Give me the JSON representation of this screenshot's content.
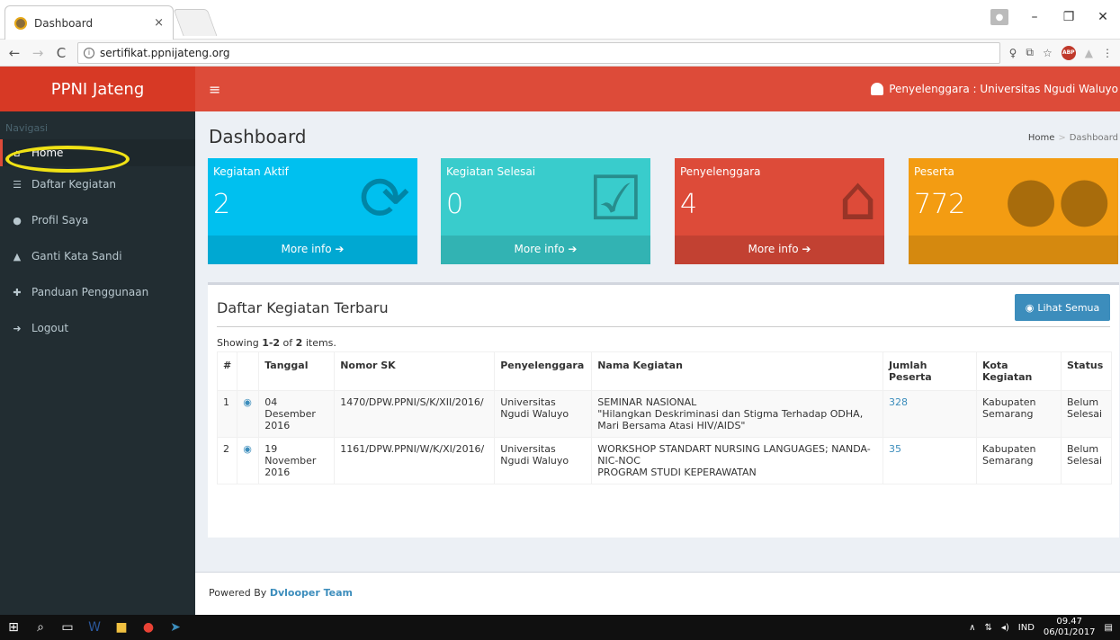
{
  "browser": {
    "tab_title": "Dashboard",
    "tab_close": "×",
    "url": "sertifikat.ppnijateng.org"
  },
  "sidebar": {
    "brand": "PPNI Jateng",
    "nav_header": "Navigasi",
    "items": [
      {
        "label": "Home",
        "icon": "home-icon",
        "glyph": "⌂"
      },
      {
        "label": "Daftar Kegiatan",
        "icon": "list-icon",
        "glyph": "☰"
      },
      {
        "label": "Profil Saya",
        "icon": "user-icon",
        "glyph": "●"
      },
      {
        "label": "Ganti Kata Sandi",
        "icon": "lock-icon",
        "glyph": "▲"
      },
      {
        "label": "Panduan Penggunaan",
        "icon": "lifebuoy-icon",
        "glyph": "✚"
      },
      {
        "label": "Logout",
        "icon": "logout-icon",
        "glyph": "➜"
      }
    ]
  },
  "topbar": {
    "menu_toggle": "≡",
    "user_label": "Penyelenggara : Universitas Ngudi Waluyo"
  },
  "page": {
    "title": "Dashboard",
    "breadcrumb_home": "Home",
    "breadcrumb_current": "Dashboard"
  },
  "stats": [
    {
      "label": "Kegiatan Aktif",
      "value": "2",
      "footer": "More info ➔",
      "icon": "refresh-icon",
      "color": "#00c0ef"
    },
    {
      "label": "Kegiatan Selesai",
      "value": "0",
      "footer": "More info ➔",
      "icon": "checkbox-icon",
      "color": "#39cccc"
    },
    {
      "label": "Penyelenggara",
      "value": "4",
      "footer": "More info ➔",
      "icon": "institution-icon",
      "color": "#dd4b39"
    },
    {
      "label": "Peserta",
      "value": "772",
      "footer": "",
      "icon": "users-icon",
      "color": "#f39c12"
    }
  ],
  "latest": {
    "title": "Daftar Kegiatan Terbaru",
    "view_all": "Lihat Semua",
    "showing_prefix": "Showing ",
    "showing_range": "1-2",
    "showing_mid": " of ",
    "showing_total": "2",
    "showing_suffix": " items.",
    "columns": [
      "#",
      "",
      "Tanggal",
      "Nomor SK",
      "Penyelenggara",
      "Nama Kegiatan",
      "Jumlah Peserta",
      "Kota Kegiatan",
      "Status"
    ],
    "rows": [
      {
        "no": "1",
        "tanggal": "04 Desember 2016",
        "nomor_sk": "1470/DPW.PPNI/S/K/XII/2016/",
        "penyelenggara": "Universitas Ngudi Waluyo",
        "nama_line1": "SEMINAR NASIONAL",
        "nama_line2": "\"Hilangkan Deskriminasi dan Stigma Terhadap ODHA, Mari Bersama Atasi HIV/AIDS\"",
        "nama_line3": "",
        "jumlah": "328",
        "kota": "Kabupaten Semarang",
        "status": "Belum Selesai"
      },
      {
        "no": "2",
        "tanggal": "19 November 2016",
        "nomor_sk": "1161/DPW.PPNI/W/K/XI/2016/",
        "penyelenggara": "Universitas Ngudi Waluyo",
        "nama_line1": "WORKSHOP STANDART NURSING LANGUAGES; NANDA-NIC-NOC",
        "nama_line2": "PROGRAM STUDI KEPERAWATAN",
        "nama_line3": "",
        "jumlah": "35",
        "kota": "Kabupaten Semarang",
        "status": "Belum Selesai"
      }
    ]
  },
  "footer": {
    "prefix": "Powered By ",
    "team": "Dvlooper Team"
  },
  "taskbar": {
    "lang": "IND",
    "time": "09.47",
    "date": "06/01/2017"
  }
}
